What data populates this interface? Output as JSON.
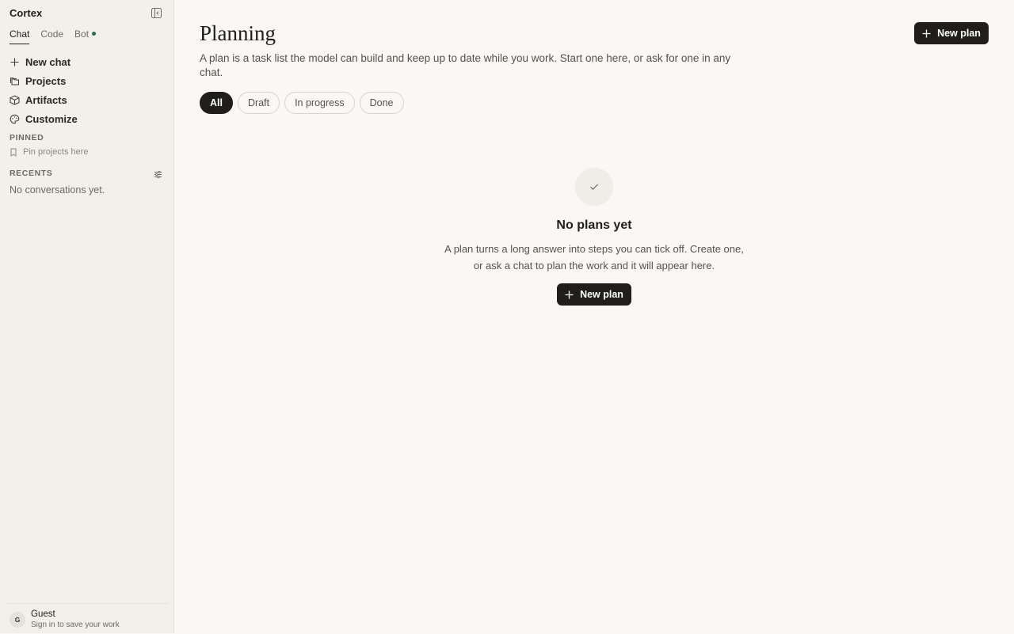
{
  "app": {
    "name": "Cortex"
  },
  "sidebar": {
    "modes": [
      {
        "label": "Chat",
        "active": true
      },
      {
        "label": "Code",
        "active": false
      },
      {
        "label": "Bot",
        "active": false,
        "status_dot_color": "#2f6b4f"
      }
    ],
    "nav": [
      {
        "label": "New chat",
        "icon": "plus-icon"
      },
      {
        "label": "Projects",
        "icon": "folders-icon"
      },
      {
        "label": "Artifacts",
        "icon": "box-icon"
      },
      {
        "label": "Customize",
        "icon": "palette-icon"
      }
    ],
    "pinned": {
      "label": "PINNED",
      "hint": "Pin projects here"
    },
    "recents": {
      "label": "RECENTS",
      "empty": "No conversations yet."
    },
    "user": {
      "initial": "G",
      "name": "Guest",
      "subtitle": "Sign in to save your work"
    }
  },
  "main": {
    "title": "Planning",
    "description": "A plan is a task list the model can build and keep up to date while you work. Start one here, or ask for one in any chat.",
    "new_plan_label": "New plan",
    "filters": [
      {
        "label": "All",
        "active": true
      },
      {
        "label": "Draft",
        "active": false
      },
      {
        "label": "In progress",
        "active": false
      },
      {
        "label": "Done",
        "active": false
      }
    ],
    "empty_state": {
      "title": "No plans yet",
      "description": "A plan turns a long answer into steps you can tick off. Create one, or ask a chat to plan the work and it will appear here.",
      "button_label": "New plan"
    }
  },
  "colors": {
    "accent_dark": "#1f1e1b",
    "background": "#f9f8f5",
    "sidebar_bg": "#f2f0eb"
  }
}
